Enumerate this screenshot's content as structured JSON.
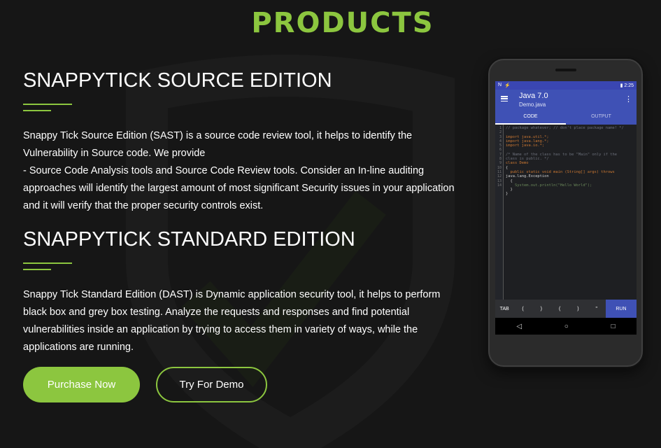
{
  "page": {
    "title": "PRODUCTS"
  },
  "sections": [
    {
      "heading": "SNAPPYTICK SOURCE EDITION",
      "lines": [
        "Snappy Tick Source Edition (SAST) is a source code review tool, it helps to identify the",
        "Vulnerability in Source code. We provide",
        "- Source Code Analysis tools and Source Code Review tools. Consider an In-line auditing",
        "approaches will identify the largest amount of most significant Security issues in your application",
        "and it will verify that the proper security controls exist."
      ]
    },
    {
      "heading": "SNAPPYTICK STANDARD EDITION",
      "lines": [
        "Snappy Tick Standard Edition (DAST) is Dynamic application security tool, it helps to perform",
        "black box and grey box testing. Analyze the requests and responses and find potential",
        "vulnerabilities inside an application by trying to access them in variety of ways, while the",
        "applications are running."
      ]
    }
  ],
  "buttons": {
    "purchase": "Purchase Now",
    "demo": "Try For Demo"
  },
  "phone": {
    "status_left": [
      "N",
      "⚡"
    ],
    "status_time": "▮ 2:25",
    "app_title": "Java 7.0",
    "app_subtitle": "Demo.java",
    "more_icon": "⋮",
    "tabs": [
      "CODE",
      "OUTPUT"
    ],
    "gutter": "1\n2\n3\n4\n5\n6\n7\n8\n9\n10\n11\n12\n13\n14",
    "code_lines": [
      {
        "cls": "cm",
        "t": "// package whatever; // don't place package name! */"
      },
      {
        "cls": "",
        "t": ""
      },
      {
        "cls": "kw",
        "t": "import java.util.*;"
      },
      {
        "cls": "kw",
        "t": "import java.lang.*;"
      },
      {
        "cls": "kw",
        "t": "import java.io.*;"
      },
      {
        "cls": "",
        "t": ""
      },
      {
        "cls": "cm",
        "t": "/* Name of the class has to be \"Main\" only if the"
      },
      {
        "cls": "cm",
        "t": "class is public. */"
      },
      {
        "cls": "kw",
        "t": "class Demo"
      },
      {
        "cls": "",
        "t": "{"
      },
      {
        "cls": "kw",
        "t": "  public static void main (String[] args) throws"
      },
      {
        "cls": "",
        "t": "java.lang.Exception"
      },
      {
        "cls": "",
        "t": "  {"
      },
      {
        "cls": "st",
        "t": "    System.out.println(\"Hello World\");"
      },
      {
        "cls": "",
        "t": "  }"
      },
      {
        "cls": "",
        "t": "}"
      }
    ],
    "keys": [
      "TAB",
      "(",
      ")",
      "(",
      ")",
      "\""
    ],
    "run": "RUN",
    "nav": [
      "◁",
      "○",
      "□"
    ]
  }
}
